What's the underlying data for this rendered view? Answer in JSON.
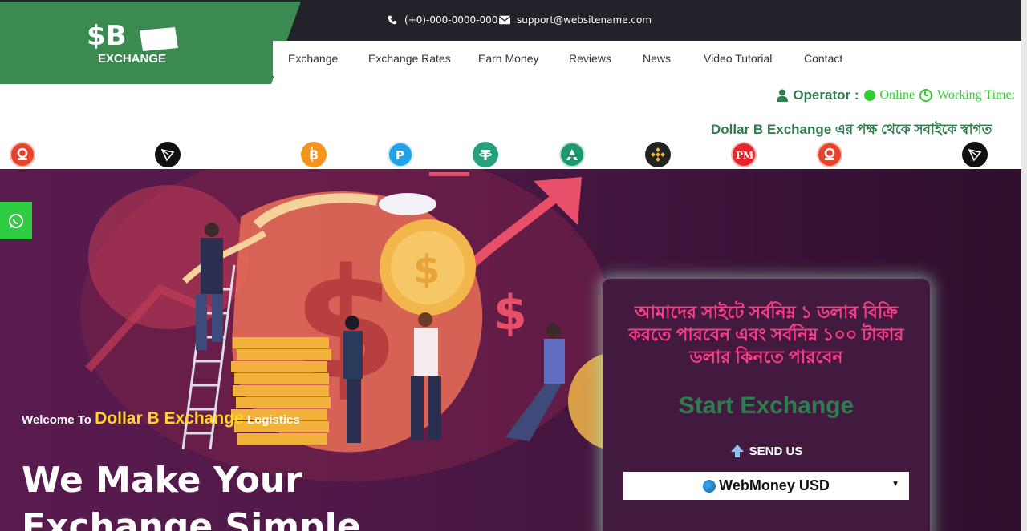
{
  "header": {
    "phone": "(+0)-000-0000-000",
    "email": "support@websitename.com",
    "logo_text": "$B EXCHANGE"
  },
  "nav": {
    "items": [
      {
        "label": "Exchange"
      },
      {
        "label": "Exchange Rates"
      },
      {
        "label": "Earn Money"
      },
      {
        "label": "Reviews"
      },
      {
        "label": "News"
      },
      {
        "label": "Video Tutorial"
      },
      {
        "label": "Contact"
      }
    ]
  },
  "status": {
    "operator_label": "Operator :",
    "online_label": "Online",
    "working_time_label": "Working Time:"
  },
  "marquee": {
    "text": "Dollar B Exchange এর পক্ষ থেকে সবাইকে স্বাগত"
  },
  "payment_icons": [
    {
      "name": "nagad-icon",
      "color": "#e8432a"
    },
    {
      "name": "tron-icon",
      "color": "#111111"
    },
    {
      "name": "bitcoin-icon",
      "color": "#f7931a"
    },
    {
      "name": "payeer-icon",
      "color": "#1fa2e8"
    },
    {
      "name": "tether-icon",
      "color": "#26a17b"
    },
    {
      "name": "airtm-icon",
      "color": "#1c9a6c"
    },
    {
      "name": "binance-icon",
      "color": "#222222"
    },
    {
      "name": "perfect-money-icon",
      "color": "#e3262a"
    },
    {
      "name": "nagad-icon",
      "color": "#e8432a"
    },
    {
      "name": "tron-icon",
      "color": "#111111"
    }
  ],
  "hero": {
    "welcome_prefix": "Welcome To",
    "welcome_brand": "Dollar B Exchange",
    "welcome_suffix": "Logistics",
    "title": "We Make Your Exchange Simple"
  },
  "exchange_panel": {
    "notice": "আমাদের সাইটে সর্বনিম্ন ১ ডলার বিক্রি করতে পারবেন এবং সর্বনিম্ন ১০০ টাকার ডলার কিনতে পারবেন",
    "start_label": "Start Exchange",
    "send_label": "SEND US",
    "selected_currency": "WebMoney USD"
  },
  "colors": {
    "topbar": "#23222b",
    "brand_green": "#2e7d4f",
    "online_green": "#33cc33",
    "hero_purple": "#4d1846",
    "notice_pink": "#ff3d86",
    "whatsapp_green": "#2ecc40",
    "brand_yellow": "#ffd52a"
  }
}
